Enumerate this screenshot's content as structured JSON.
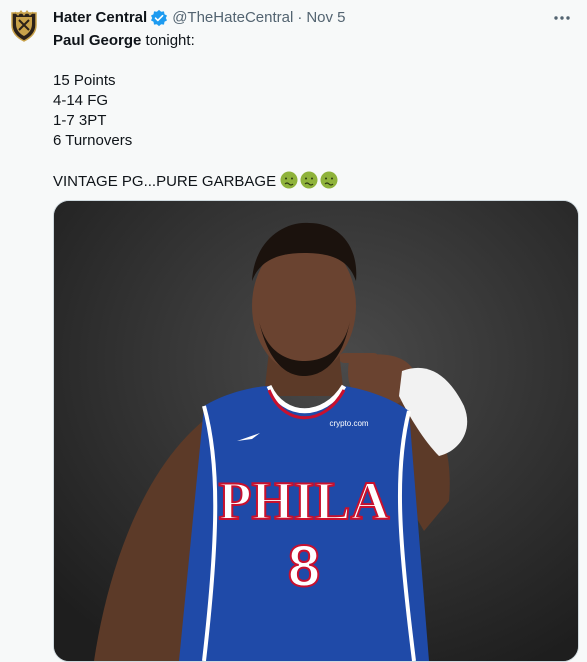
{
  "account": {
    "display_name": "Hater Central",
    "handle": "@TheHateCentral",
    "separator": "·",
    "date": "Nov 5",
    "verified": true,
    "avatar_icon": "crest-logo-icon"
  },
  "tweet": {
    "mention": "Paul George",
    "intro_rest": " tonight:",
    "stats": [
      "15 Points",
      "4-14 FG",
      "1-7 3PT",
      "6 Turnovers"
    ],
    "closing": "VINTAGE PG...PURE GARBAGE",
    "emojis": [
      "nauseated-face-icon",
      "nauseated-face-icon",
      "nauseated-face-icon"
    ]
  },
  "media": {
    "jersey_text": "PHILA",
    "jersey_number": "8",
    "sponsor_patch": "crypto.com"
  },
  "colors": {
    "background": "#f7f9f9",
    "verified_blue": "#1d9bf0",
    "jersey_blue": "#1f4aa8",
    "jersey_red": "#c8102e",
    "emoji_green": "#8fb33b"
  }
}
